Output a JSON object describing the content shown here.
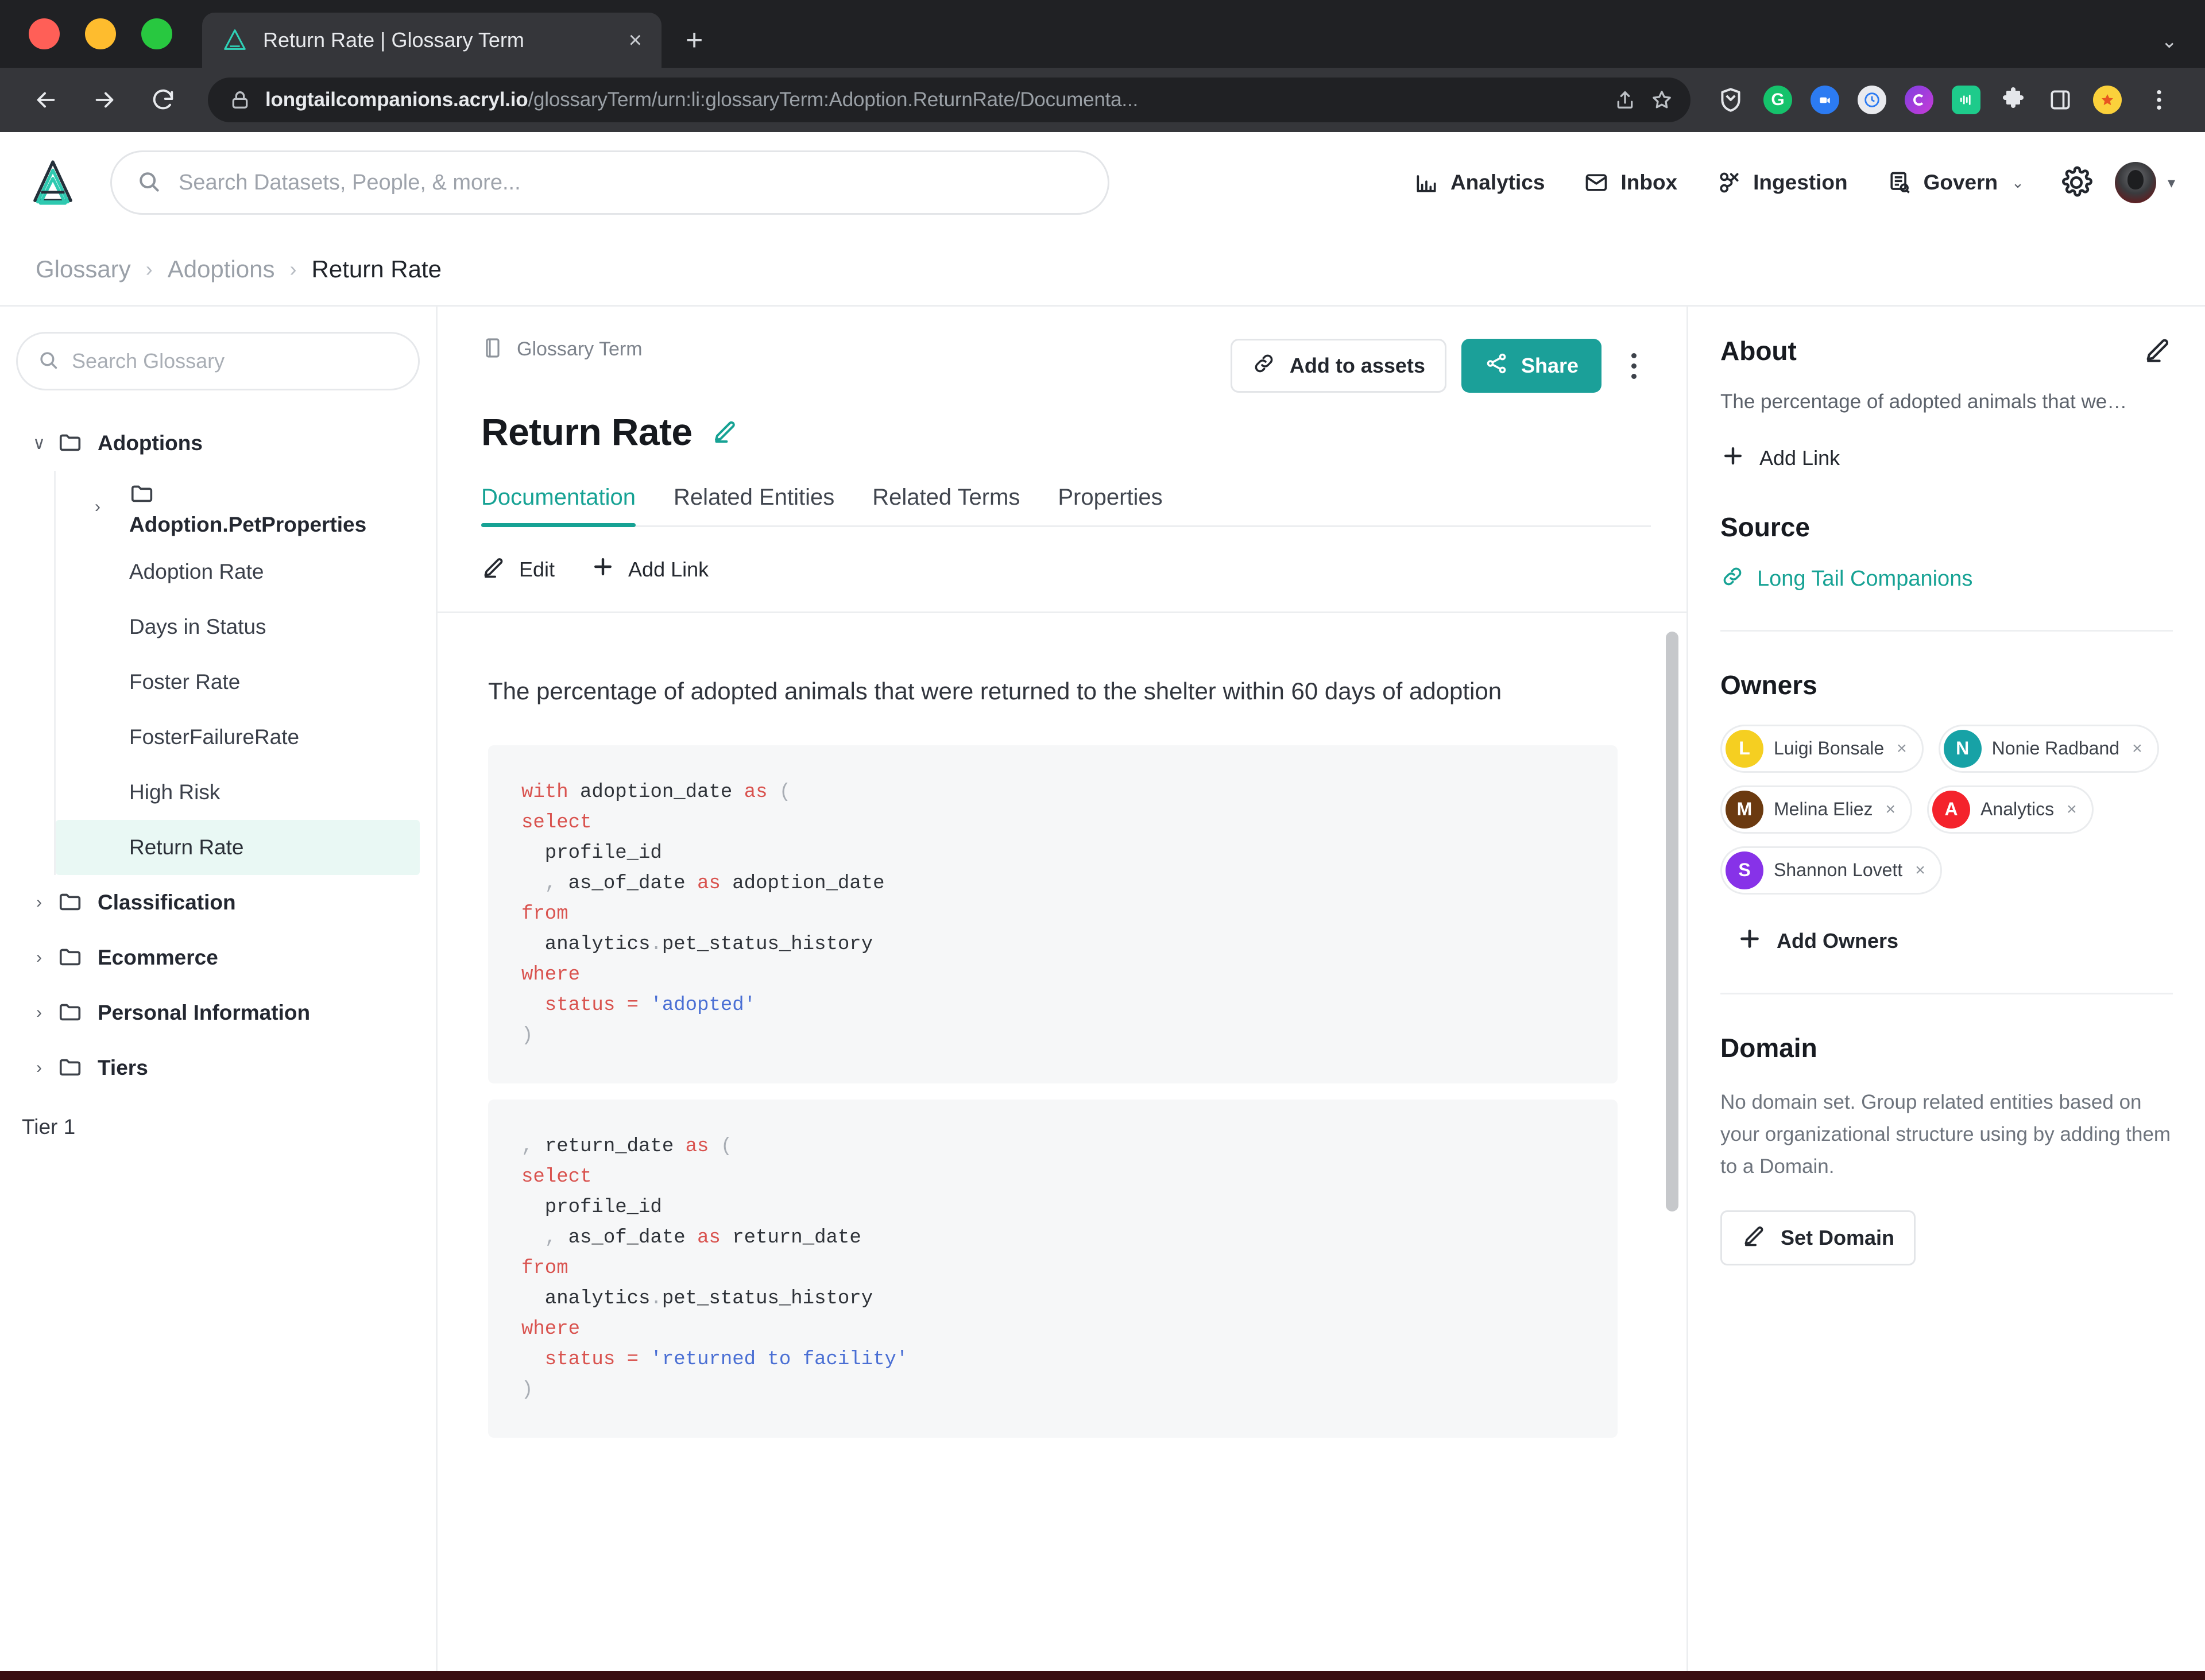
{
  "browser": {
    "tab_title": "Return Rate | Glossary Term",
    "tab_close_label": "×",
    "new_tab_label": "+",
    "url_domain": "longtailcompanions.acryl.io",
    "url_path": "/glossaryTerm/urn:li:glossaryTerm:Adoption.ReturnRate/Documenta...",
    "window_chevron": "⌄"
  },
  "app": {
    "search": {
      "placeholder": "Search Datasets, People, & more...",
      "value": ""
    },
    "nav": [
      {
        "label": "Analytics",
        "icon": "bar-chart-icon"
      },
      {
        "label": "Inbox",
        "icon": "inbox-icon"
      },
      {
        "label": "Ingestion",
        "icon": "ingestion-icon"
      },
      {
        "label": "Govern",
        "icon": "govern-icon",
        "chevron": "⌄"
      }
    ]
  },
  "breadcrumb": {
    "items": [
      "Glossary",
      "Adoptions",
      "Return Rate"
    ],
    "separator": "›"
  },
  "sidebar": {
    "search": {
      "placeholder": "Search Glossary",
      "value": ""
    },
    "root": {
      "label": "Adoptions",
      "caret": "∨"
    },
    "child_node": {
      "label": "Adoption.PetProperties",
      "caret": "›"
    },
    "leaves": [
      {
        "label": "Adoption Rate",
        "selected": false
      },
      {
        "label": "Days in Status",
        "selected": false
      },
      {
        "label": "Foster Rate",
        "selected": false
      },
      {
        "label": "FosterFailureRate",
        "selected": false
      },
      {
        "label": "High Risk",
        "selected": false
      },
      {
        "label": "Return Rate",
        "selected": true
      }
    ],
    "groups": [
      {
        "label": "Classification",
        "caret": "›"
      },
      {
        "label": "Ecommerce",
        "caret": "›"
      },
      {
        "label": "Personal Information",
        "caret": "›"
      },
      {
        "label": "Tiers",
        "caret": "›"
      }
    ],
    "footer": "Tier 1"
  },
  "main": {
    "entity_type": "Glossary Term",
    "title": "Return Rate",
    "actions": {
      "add_to_assets": "Add to assets",
      "share": "Share"
    },
    "tabs": [
      {
        "label": "Documentation",
        "active": true
      },
      {
        "label": "Related Entities",
        "active": false
      },
      {
        "label": "Related Terms",
        "active": false
      },
      {
        "label": "Properties",
        "active": false
      }
    ],
    "doc_toolbar": {
      "edit": "Edit",
      "add_link": "Add Link"
    },
    "description": "The percentage of adopted animals that were returned to the shelter within 60 days of adoption",
    "code_block_1": {
      "lines": [
        [
          [
            "with ",
            "k"
          ],
          [
            "adoption_date ",
            "i"
          ],
          [
            "as ",
            "k"
          ],
          [
            "(",
            "p"
          ]
        ],
        [
          [
            "select",
            "k"
          ]
        ],
        [
          [
            "  profile_id",
            "i"
          ]
        ],
        [
          [
            "  , ",
            "p"
          ],
          [
            "as_of_date ",
            "i"
          ],
          [
            "as ",
            "k"
          ],
          [
            "adoption_date",
            "i"
          ]
        ],
        [
          [
            "from",
            "k"
          ]
        ],
        [
          [
            "  analytics",
            "i"
          ],
          [
            ".",
            "p"
          ],
          [
            "pet_status_history",
            "i"
          ]
        ],
        [
          [
            "where",
            "k"
          ]
        ],
        [
          [
            "  status ",
            "k"
          ],
          [
            "= ",
            "k"
          ],
          [
            "'adopted'",
            "s"
          ]
        ],
        [
          [
            ")",
            "p"
          ]
        ]
      ]
    },
    "code_block_2": {
      "lines": [
        [
          [
            ", ",
            "p"
          ],
          [
            "return_date ",
            "i"
          ],
          [
            "as ",
            "k"
          ],
          [
            "(",
            "p"
          ]
        ],
        [
          [
            "select",
            "k"
          ]
        ],
        [
          [
            "  profile_id",
            "i"
          ]
        ],
        [
          [
            "  , ",
            "p"
          ],
          [
            "as_of_date ",
            "i"
          ],
          [
            "as ",
            "k"
          ],
          [
            "return_date",
            "i"
          ]
        ],
        [
          [
            "from",
            "k"
          ]
        ],
        [
          [
            "  analytics",
            "i"
          ],
          [
            ".",
            "p"
          ],
          [
            "pet_status_history",
            "i"
          ]
        ],
        [
          [
            "where",
            "k"
          ]
        ],
        [
          [
            "  status ",
            "k"
          ],
          [
            "= ",
            "k"
          ],
          [
            "'returned to facility'",
            "s"
          ]
        ],
        [
          [
            ")",
            "p"
          ]
        ]
      ]
    }
  },
  "right": {
    "about": {
      "title": "About",
      "text": "The percentage of adopted animals that we…",
      "add_link": "Add Link"
    },
    "source": {
      "title": "Source",
      "link": "Long Tail Companions"
    },
    "owners": {
      "title": "Owners",
      "items": [
        {
          "name": "Luigi Bonsale",
          "initial": "L",
          "color": "#f5cf21",
          "remove": "×"
        },
        {
          "name": "Nonie Radband",
          "initial": "N",
          "color": "#17a2a6",
          "remove": "×"
        },
        {
          "name": "Melina Eliez",
          "initial": "M",
          "color": "#6b3a10",
          "remove": "×"
        },
        {
          "name": "Analytics",
          "initial": "A",
          "color": "#f4232c",
          "remove": "×"
        },
        {
          "name": "Shannon Lovett",
          "initial": "S",
          "color": "#8732e8",
          "remove": "×"
        }
      ],
      "add_label": "Add Owners"
    },
    "domain": {
      "title": "Domain",
      "text": "No domain set. Group related entities based on your organizational structure using by adding them to a Domain.",
      "button": "Set Domain"
    }
  },
  "colors": {
    "accent_teal": "#16a294",
    "share_teal": "#1ba099",
    "selected_bg": "#e9f8f4"
  }
}
